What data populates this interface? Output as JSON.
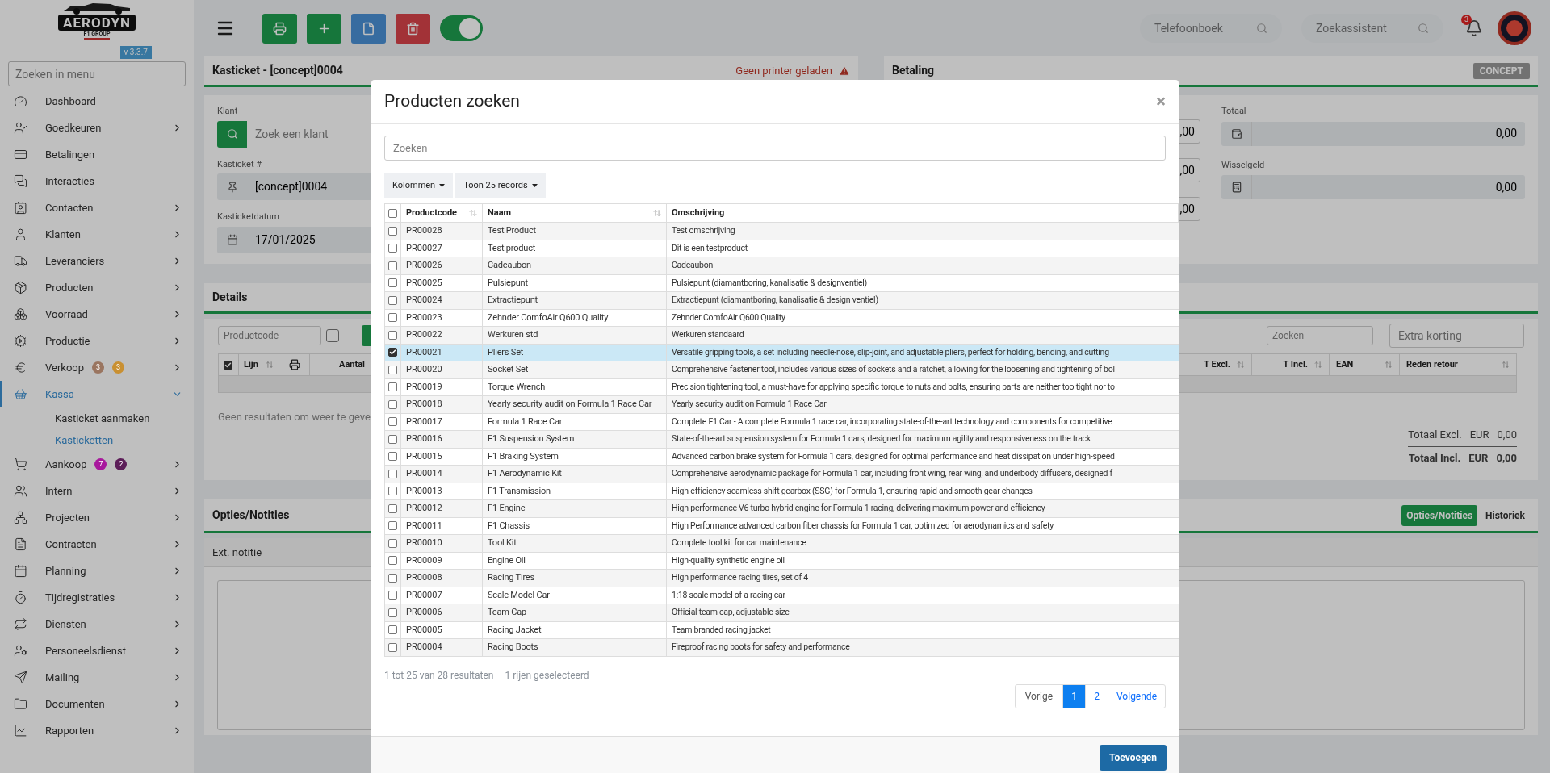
{
  "sidebar": {
    "logo": {
      "name": "AERODYN",
      "tagline": "F1 GROUP"
    },
    "version": "v 3.3.7",
    "search": {
      "placeholder": "Zoeken in menu"
    },
    "items": [
      {
        "label": "Dashboard",
        "kind": "link",
        "selected": false
      },
      {
        "label": "Goedkeuren",
        "kind": "group",
        "expanded": false,
        "selected": false
      },
      {
        "label": "Betalingen",
        "kind": "link",
        "selected": false
      },
      {
        "label": "Interacties",
        "kind": "link",
        "selected": false
      },
      {
        "label": "Contacten",
        "kind": "group",
        "expanded": false,
        "selected": false
      },
      {
        "label": "Klanten",
        "kind": "group",
        "expanded": false,
        "selected": false
      },
      {
        "label": "Leveranciers",
        "kind": "group",
        "expanded": false,
        "selected": false
      },
      {
        "label": "Producten",
        "kind": "group",
        "expanded": false,
        "selected": false
      },
      {
        "label": "Voorraad",
        "kind": "group",
        "expanded": false,
        "selected": false
      },
      {
        "label": "Productie",
        "kind": "group",
        "expanded": false,
        "selected": false
      },
      {
        "label": "Verkoop",
        "kind": "group",
        "expanded": false,
        "selected": false,
        "badges": [
          {
            "text": "3",
            "color": "#9a7560"
          },
          {
            "text": "3",
            "color": "#c99032"
          }
        ]
      },
      {
        "label": "Kassa",
        "kind": "group",
        "expanded": true,
        "selected": true,
        "children": [
          {
            "label": "Kasticket aanmaken",
            "selected": false
          },
          {
            "label": "Kasticketten",
            "selected": true
          }
        ]
      },
      {
        "label": "Aankoop",
        "kind": "group",
        "expanded": false,
        "selected": false,
        "badges": [
          {
            "text": "7",
            "color": "#a8189d"
          },
          {
            "text": "2",
            "color": "#5c1e58"
          }
        ]
      },
      {
        "label": "Intern",
        "kind": "group",
        "expanded": false,
        "selected": false
      },
      {
        "label": "Projecten",
        "kind": "group",
        "expanded": false,
        "selected": false
      },
      {
        "label": "Contracten",
        "kind": "group",
        "expanded": false,
        "selected": false
      },
      {
        "label": "Planning",
        "kind": "group",
        "expanded": false,
        "selected": false
      },
      {
        "label": "Tijdregistraties",
        "kind": "group",
        "expanded": false,
        "selected": false
      },
      {
        "label": "Diensten",
        "kind": "group",
        "expanded": false,
        "selected": false
      },
      {
        "label": "Personeelsdienst",
        "kind": "group",
        "expanded": false,
        "selected": false
      },
      {
        "label": "Mailing",
        "kind": "group",
        "expanded": false,
        "selected": false
      },
      {
        "label": "Documenten",
        "kind": "group",
        "expanded": false,
        "selected": false
      },
      {
        "label": "Rapporten",
        "kind": "group",
        "expanded": false,
        "selected": false
      }
    ]
  },
  "toolbar": {
    "toggle": {
      "on": true
    }
  },
  "header": {
    "search_fields": [
      {
        "placeholder": "Telefoonboek"
      },
      {
        "placeholder": "Zoekassistent"
      }
    ],
    "notifications": "3"
  },
  "ticket_card": {
    "title": "Kasticket - [concept]0004",
    "warning": "Geen printer geladen",
    "fields": [
      {
        "label": "Klant",
        "kind": "search",
        "placeholder": "Zoek een klant"
      },
      {
        "label": "Kasticket #",
        "kind": "pin",
        "value": "[concept]0004"
      },
      {
        "label": "Kasticketdatum",
        "kind": "date",
        "value": "17/01/2025"
      }
    ]
  },
  "payment_card": {
    "title": "Betaling",
    "status": "CONCEPT",
    "partial_values": [
      ",00",
      ",00",
      ",00"
    ],
    "fields": [
      {
        "label": "Totaal",
        "kind": "money",
        "value": "0,00"
      },
      {
        "label": "Wisselgeld",
        "kind": "register",
        "value": "0,00"
      }
    ]
  },
  "details_card": {
    "title": "Details",
    "productcode_placeholder": "Productcode",
    "line_checkbox": {
      "checked": false
    },
    "search_placeholder": "Zoeken",
    "discount_placeholder": "Extra korting",
    "columns_left": [
      {
        "kind": "checkbox",
        "checked": true
      },
      {
        "kind": "text",
        "label": "Lijn",
        "sortable": true
      },
      {
        "kind": "printer"
      },
      {
        "kind": "text",
        "label": "Aantal",
        "sortable": false
      }
    ],
    "columns_right": [
      {
        "label": "T Excl.",
        "sortable": true
      },
      {
        "label": "T Incl.",
        "sortable": true
      },
      {
        "label": "EAN",
        "sortable": true
      },
      {
        "label": "Reden retour",
        "sortable": true
      }
    ],
    "empty_message": "Geen resultaten om weer te geve",
    "totals": [
      {
        "label": "Totaal Excl.",
        "currency": "EUR",
        "value": "0,00",
        "bold": false
      },
      {
        "label": "Totaal Incl.",
        "currency": "EUR",
        "value": "0,00",
        "bold": true
      }
    ]
  },
  "notes_card": {
    "title": "Opties/Notities",
    "tabs": [
      {
        "label": "Opties/Notities",
        "selected": true
      },
      {
        "label": "Historiek",
        "selected": false
      }
    ],
    "section": "Ext. notitie"
  },
  "modal": {
    "title": "Producten zoeken",
    "close": "×",
    "search_placeholder": "Zoeken",
    "buttons": [
      "Kolommen",
      "Toon 25 records"
    ],
    "select_all": {
      "checked": false
    },
    "columns": [
      {
        "label": "Productcode",
        "sortable": true
      },
      {
        "label": "Naam",
        "sortable": true
      },
      {
        "label": "Omschrijving",
        "sortable": false
      }
    ],
    "rows": [
      {
        "code": "PR00028",
        "name": "Test Product",
        "description": "Test omschrijving",
        "selected": false
      },
      {
        "code": "PR00027",
        "name": "Test product",
        "description": "Dit is een testproduct",
        "selected": false
      },
      {
        "code": "PR00026",
        "name": "Cadeaubon",
        "description": "Cadeaubon",
        "selected": false
      },
      {
        "code": "PR00025",
        "name": "Pulsiepunt",
        "description": "Pulsiepunt (diamantboring, kanalisatie & designventiel)",
        "selected": false
      },
      {
        "code": "PR00024",
        "name": "Extractiepunt",
        "description": "Extractiepunt (diamantboring, kanalisatie & design ventiel)",
        "selected": false
      },
      {
        "code": "PR00023",
        "name": "Zehnder ComfoAir Q600 Quality",
        "description": "Zehnder ComfoAir Q600 Quality",
        "selected": false
      },
      {
        "code": "PR00022",
        "name": "Werkuren std",
        "description": "Werkuren standaard",
        "selected": false
      },
      {
        "code": "PR00021",
        "name": "Pliers Set",
        "description": "Versatile gripping tools, a set including needle-nose, slip-joint, and adjustable pliers, perfect for holding, bending, and cutting",
        "selected": true
      },
      {
        "code": "PR00020",
        "name": "Socket Set",
        "description": "Comprehensive fastener tool, includes various sizes of sockets and a ratchet, allowing for the loosening and tightening of bol",
        "selected": false
      },
      {
        "code": "PR00019",
        "name": "Torque Wrench",
        "description": "Precision tightening tool, a must-have for applying specific torque to nuts and bolts, ensuring parts are neither too tight nor to",
        "selected": false
      },
      {
        "code": "PR00018",
        "name": "Yearly security audit on Formula 1 Race Car",
        "description": "Yearly security audit on Formula 1 Race Car",
        "selected": false
      },
      {
        "code": "PR00017",
        "name": "Formula 1 Race Car",
        "description": "Complete F1 Car - A complete Formula 1 race car, incorporating state-of-the-art technology and components for competitive",
        "selected": false
      },
      {
        "code": "PR00016",
        "name": "F1 Suspension System",
        "description": "State-of-the-art suspension system for Formula 1 cars, designed for maximum agility and responsiveness on the track",
        "selected": false
      },
      {
        "code": "PR00015",
        "name": "F1 Braking System",
        "description": "Advanced carbon brake system for Formula 1 cars, designed for optimal performance and heat dissipation under high-speed",
        "selected": false
      },
      {
        "code": "PR00014",
        "name": "F1 Aerodynamic Kit",
        "description": "Comprehensive aerodynamic package for Formula 1 car, including front wing, rear wing, and underbody diffusers, designed f",
        "selected": false
      },
      {
        "code": "PR00013",
        "name": "F1 Transmission",
        "description": "High-efficiency seamless shift gearbox (SSG) for Formula 1, ensuring rapid and smooth gear changes",
        "selected": false
      },
      {
        "code": "PR00012",
        "name": "F1 Engine",
        "description": "High-performance V6 turbo hybrid engine for Formula 1 racing, delivering maximum power and efficiency",
        "selected": false
      },
      {
        "code": "PR00011",
        "name": "F1 Chassis",
        "description": "High Performance advanced carbon fiber chassis for Formula 1 car, optimized for aerodynamics and safety",
        "selected": false
      },
      {
        "code": "PR00010",
        "name": "Tool Kit",
        "description": "Complete tool kit for car maintenance",
        "selected": false
      },
      {
        "code": "PR00009",
        "name": "Engine Oil",
        "description": "High-quality synthetic engine oil",
        "selected": false
      },
      {
        "code": "PR00008",
        "name": "Racing Tires",
        "description": "High performance racing tires, set of 4",
        "selected": false
      },
      {
        "code": "PR00007",
        "name": "Scale Model Car",
        "description": "1:18 scale model of a racing car",
        "selected": false
      },
      {
        "code": "PR00006",
        "name": "Team Cap",
        "description": "Official team cap, adjustable size",
        "selected": false
      },
      {
        "code": "PR00005",
        "name": "Racing Jacket",
        "description": "Team branded racing jacket",
        "selected": false
      },
      {
        "code": "PR00004",
        "name": "Racing Boots",
        "description": "Fireproof racing boots for safety and performance",
        "selected": false
      }
    ],
    "info": "1 tot 25 van 28 resultaten",
    "selection_info": "1 rijen geselecteerd",
    "pagination": {
      "previous": "Vorige",
      "pages": [
        {
          "label": "1",
          "selected": true
        },
        {
          "label": "2",
          "selected": false
        }
      ],
      "next": "Volgende"
    },
    "submit": "Toevoegen"
  }
}
